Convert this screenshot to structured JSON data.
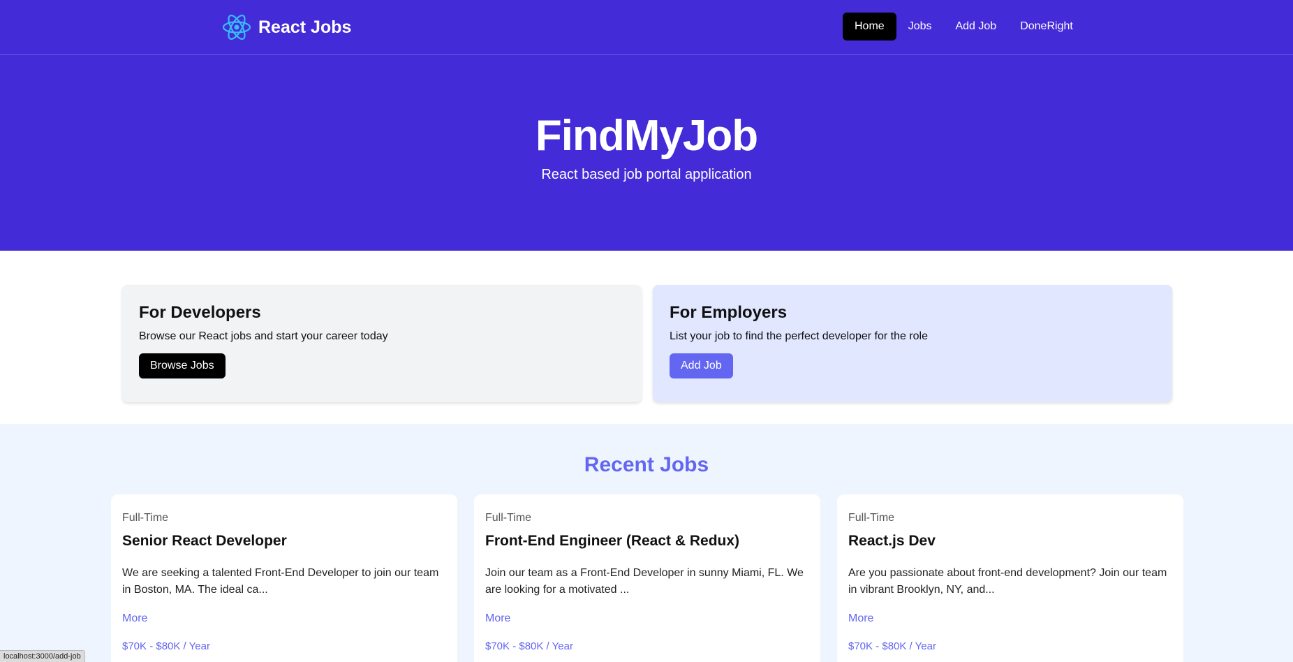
{
  "nav": {
    "brand": "React Jobs",
    "links": [
      "Home",
      "Jobs",
      "Add Job",
      "DoneRight"
    ],
    "active": "Home",
    "logo_icon": "react-atom-icon",
    "logo_color": "#38bdf8"
  },
  "hero": {
    "title": "FindMyJob",
    "subtitle": "React based job portal application"
  },
  "cards": {
    "developers": {
      "title": "For Developers",
      "text": "Browse our React jobs and start your career today",
      "button": "Browse Jobs"
    },
    "employers": {
      "title": "For Employers",
      "text": "List your job to find the perfect developer for the role",
      "button": "Add Job"
    }
  },
  "recent": {
    "title": "Recent Jobs",
    "jobs": [
      {
        "type": "Full-Time",
        "title": "Senior React Developer",
        "desc_line1": "We are seeking a talented Front-End Developer to join our team",
        "desc_line2": "in Boston, MA. The ideal ca...",
        "more": "More",
        "salary": "$70K - $80K / Year"
      },
      {
        "type": "Full-Time",
        "title": "Front-End Engineer (React & Redux)",
        "desc_line1": "Join our team as a Front-End Developer in sunny Miami, FL. We",
        "desc_line2": "are looking for a motivated ...",
        "more": "More",
        "salary": "$70K - $80K / Year"
      },
      {
        "type": "Full-Time",
        "title": "React.js Dev",
        "desc_line1": "Are you passionate about front-end development? Join our team",
        "desc_line2": "in vibrant Brooklyn, NY, and...",
        "more": "More",
        "salary": "$70K - $80K / Year"
      }
    ]
  },
  "statusbar": {
    "url": "localhost:3000/add-job"
  },
  "colors": {
    "primary": "#432bd8",
    "accent": "#6366f1",
    "employer_card": "#e0e7fe",
    "developer_card": "#f2f3f5",
    "recent_bg": "#eef5fe"
  }
}
